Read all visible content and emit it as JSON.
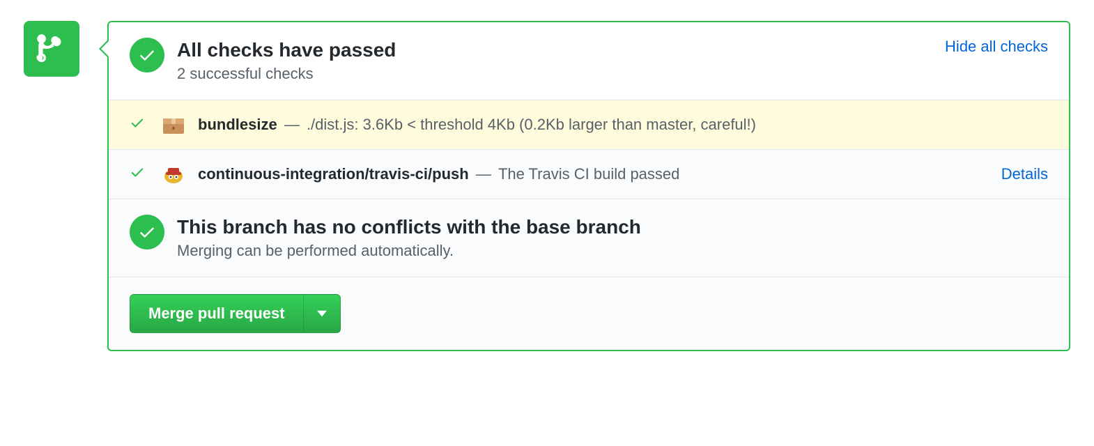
{
  "checks_header": {
    "title": "All checks have passed",
    "subtitle": "2 successful checks",
    "toggle_label": "Hide all checks"
  },
  "checks": [
    {
      "name": "bundlesize",
      "message": "./dist.js: 3.6Kb < threshold 4Kb (0.2Kb larger than master, careful!)",
      "icon": "package-icon",
      "highlight": true
    },
    {
      "name": "continuous-integration/travis-ci/push",
      "message": "The Travis CI build passed",
      "icon": "travis-icon",
      "details_label": "Details",
      "highlight": false
    }
  ],
  "conflicts": {
    "title": "This branch has no conflicts with the base branch",
    "subtitle": "Merging can be performed automatically."
  },
  "merge_button": {
    "label": "Merge pull request"
  },
  "colors": {
    "success_green": "#2cbe4e",
    "link_blue": "#0366d6",
    "highlight_bg": "#fffbdd"
  }
}
